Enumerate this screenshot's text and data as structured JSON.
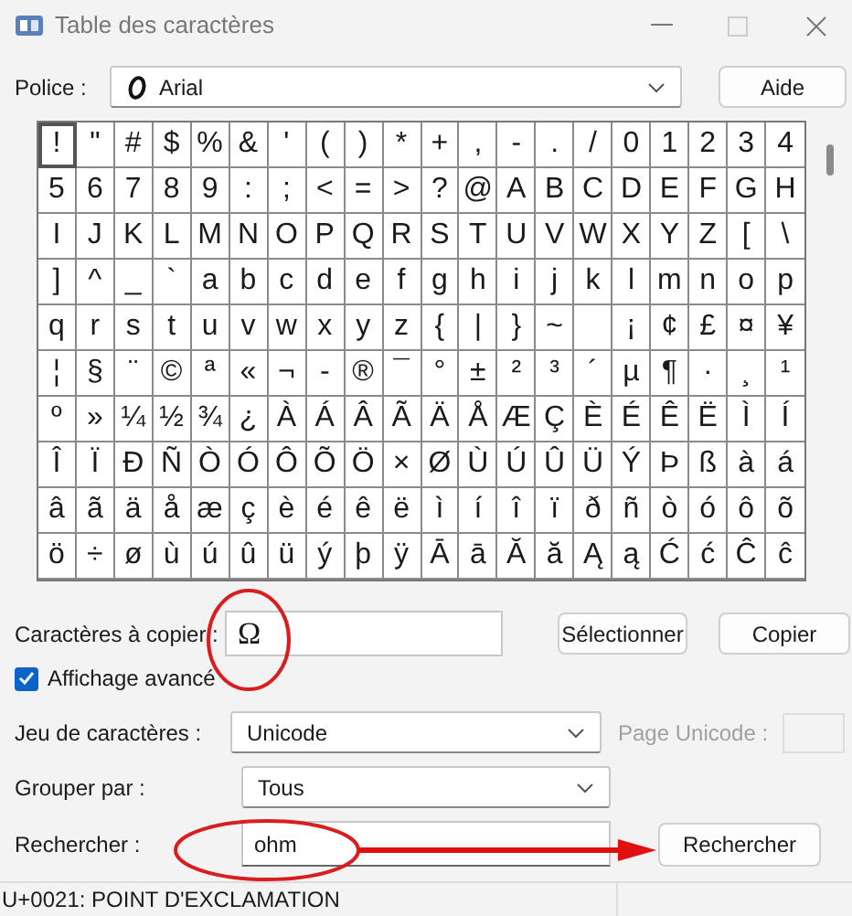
{
  "window": {
    "title": "Table des caractères"
  },
  "font": {
    "label": "Police :",
    "value": "Arial"
  },
  "help_button": "Aide",
  "grid": {
    "rows": [
      {
        "cells": [
          {
            "char": "!",
            "selected": true
          },
          {
            "char": "\"",
            "selected": false
          },
          {
            "char": "#",
            "selected": false
          },
          {
            "char": "$",
            "selected": false
          },
          {
            "char": "%",
            "selected": false
          },
          {
            "char": "&",
            "selected": false
          },
          {
            "char": "'",
            "selected": false
          },
          {
            "char": "(",
            "selected": false
          },
          {
            "char": ")",
            "selected": false
          },
          {
            "char": "*",
            "selected": false
          },
          {
            "char": "+",
            "selected": false
          },
          {
            "char": ",",
            "selected": false
          },
          {
            "char": "-",
            "selected": false
          },
          {
            "char": ".",
            "selected": false
          },
          {
            "char": "/",
            "selected": false
          },
          {
            "char": "0",
            "selected": false
          },
          {
            "char": "1",
            "selected": false
          },
          {
            "char": "2",
            "selected": false
          },
          {
            "char": "3",
            "selected": false
          },
          {
            "char": "4",
            "selected": false
          }
        ]
      },
      {
        "cells": [
          {
            "char": "5",
            "selected": false
          },
          {
            "char": "6",
            "selected": false
          },
          {
            "char": "7",
            "selected": false
          },
          {
            "char": "8",
            "selected": false
          },
          {
            "char": "9",
            "selected": false
          },
          {
            "char": ":",
            "selected": false
          },
          {
            "char": ";",
            "selected": false
          },
          {
            "char": "<",
            "selected": false
          },
          {
            "char": "=",
            "selected": false
          },
          {
            "char": ">",
            "selected": false
          },
          {
            "char": "?",
            "selected": false
          },
          {
            "char": "@",
            "selected": false
          },
          {
            "char": "A",
            "selected": false
          },
          {
            "char": "B",
            "selected": false
          },
          {
            "char": "C",
            "selected": false
          },
          {
            "char": "D",
            "selected": false
          },
          {
            "char": "E",
            "selected": false
          },
          {
            "char": "F",
            "selected": false
          },
          {
            "char": "G",
            "selected": false
          },
          {
            "char": "H",
            "selected": false
          }
        ]
      },
      {
        "cells": [
          {
            "char": "I",
            "selected": false
          },
          {
            "char": "J",
            "selected": false
          },
          {
            "char": "K",
            "selected": false
          },
          {
            "char": "L",
            "selected": false
          },
          {
            "char": "M",
            "selected": false
          },
          {
            "char": "N",
            "selected": false
          },
          {
            "char": "O",
            "selected": false
          },
          {
            "char": "P",
            "selected": false
          },
          {
            "char": "Q",
            "selected": false
          },
          {
            "char": "R",
            "selected": false
          },
          {
            "char": "S",
            "selected": false
          },
          {
            "char": "T",
            "selected": false
          },
          {
            "char": "U",
            "selected": false
          },
          {
            "char": "V",
            "selected": false
          },
          {
            "char": "W",
            "selected": false
          },
          {
            "char": "X",
            "selected": false
          },
          {
            "char": "Y",
            "selected": false
          },
          {
            "char": "Z",
            "selected": false
          },
          {
            "char": "[",
            "selected": false
          },
          {
            "char": "\\",
            "selected": false
          }
        ]
      },
      {
        "cells": [
          {
            "char": "]",
            "selected": false
          },
          {
            "char": "^",
            "selected": false
          },
          {
            "char": "_",
            "selected": false
          },
          {
            "char": "`",
            "selected": false
          },
          {
            "char": "a",
            "selected": false
          },
          {
            "char": "b",
            "selected": false
          },
          {
            "char": "c",
            "selected": false
          },
          {
            "char": "d",
            "selected": false
          },
          {
            "char": "e",
            "selected": false
          },
          {
            "char": "f",
            "selected": false
          },
          {
            "char": "g",
            "selected": false
          },
          {
            "char": "h",
            "selected": false
          },
          {
            "char": "i",
            "selected": false
          },
          {
            "char": "j",
            "selected": false
          },
          {
            "char": "k",
            "selected": false
          },
          {
            "char": "l",
            "selected": false
          },
          {
            "char": "m",
            "selected": false
          },
          {
            "char": "n",
            "selected": false
          },
          {
            "char": "o",
            "selected": false
          },
          {
            "char": "p",
            "selected": false
          }
        ]
      },
      {
        "cells": [
          {
            "char": "q",
            "selected": false
          },
          {
            "char": "r",
            "selected": false
          },
          {
            "char": "s",
            "selected": false
          },
          {
            "char": "t",
            "selected": false
          },
          {
            "char": "u",
            "selected": false
          },
          {
            "char": "v",
            "selected": false
          },
          {
            "char": "w",
            "selected": false
          },
          {
            "char": "x",
            "selected": false
          },
          {
            "char": "y",
            "selected": false
          },
          {
            "char": "z",
            "selected": false
          },
          {
            "char": "{",
            "selected": false
          },
          {
            "char": "|",
            "selected": false
          },
          {
            "char": "}",
            "selected": false
          },
          {
            "char": "~",
            "selected": false
          },
          {
            "selected": false
          },
          {
            "char": "¡",
            "selected": false
          },
          {
            "char": "¢",
            "selected": false
          },
          {
            "char": "£",
            "selected": false
          },
          {
            "char": "¤",
            "selected": false
          },
          {
            "char": "¥",
            "selected": false
          }
        ]
      },
      {
        "cells": [
          {
            "char": "¦",
            "selected": false
          },
          {
            "char": "§",
            "selected": false
          },
          {
            "char": "¨",
            "selected": false
          },
          {
            "char": "©",
            "selected": false
          },
          {
            "char": "ª",
            "selected": false
          },
          {
            "char": "«",
            "selected": false
          },
          {
            "char": "¬",
            "selected": false
          },
          {
            "char": "-",
            "selected": false
          },
          {
            "char": "®",
            "selected": false
          },
          {
            "char": "¯",
            "selected": false
          },
          {
            "char": "°",
            "selected": false
          },
          {
            "char": "±",
            "selected": false
          },
          {
            "char": "²",
            "selected": false
          },
          {
            "char": "³",
            "selected": false
          },
          {
            "char": "´",
            "selected": false
          },
          {
            "char": "µ",
            "selected": false
          },
          {
            "char": "¶",
            "selected": false
          },
          {
            "char": "·",
            "selected": false
          },
          {
            "char": "¸",
            "selected": false
          },
          {
            "char": "¹",
            "selected": false
          }
        ]
      },
      {
        "cells": [
          {
            "char": "º",
            "selected": false
          },
          {
            "char": "»",
            "selected": false
          },
          {
            "char": "¼",
            "selected": false
          },
          {
            "char": "½",
            "selected": false
          },
          {
            "char": "¾",
            "selected": false
          },
          {
            "char": "¿",
            "selected": false
          },
          {
            "char": "À",
            "selected": false
          },
          {
            "char": "Á",
            "selected": false
          },
          {
            "char": "Â",
            "selected": false
          },
          {
            "char": "Ã",
            "selected": false
          },
          {
            "char": "Ä",
            "selected": false
          },
          {
            "char": "Å",
            "selected": false
          },
          {
            "char": "Æ",
            "selected": false
          },
          {
            "char": "Ç",
            "selected": false
          },
          {
            "char": "È",
            "selected": false
          },
          {
            "char": "É",
            "selected": false
          },
          {
            "char": "Ê",
            "selected": false
          },
          {
            "char": "Ë",
            "selected": false
          },
          {
            "char": "Ì",
            "selected": false
          },
          {
            "char": "Í",
            "selected": false
          }
        ]
      },
      {
        "cells": [
          {
            "char": "Î",
            "selected": false
          },
          {
            "char": "Ï",
            "selected": false
          },
          {
            "char": "Ð",
            "selected": false
          },
          {
            "char": "Ñ",
            "selected": false
          },
          {
            "char": "Ò",
            "selected": false
          },
          {
            "char": "Ó",
            "selected": false
          },
          {
            "char": "Ô",
            "selected": false
          },
          {
            "char": "Õ",
            "selected": false
          },
          {
            "char": "Ö",
            "selected": false
          },
          {
            "char": "×",
            "selected": false
          },
          {
            "char": "Ø",
            "selected": false
          },
          {
            "char": "Ù",
            "selected": false
          },
          {
            "char": "Ú",
            "selected": false
          },
          {
            "char": "Û",
            "selected": false
          },
          {
            "char": "Ü",
            "selected": false
          },
          {
            "char": "Ý",
            "selected": false
          },
          {
            "char": "Þ",
            "selected": false
          },
          {
            "char": "ß",
            "selected": false
          },
          {
            "char": "à",
            "selected": false
          },
          {
            "char": "á",
            "selected": false
          }
        ]
      },
      {
        "cells": [
          {
            "char": "â",
            "selected": false
          },
          {
            "char": "ã",
            "selected": false
          },
          {
            "char": "ä",
            "selected": false
          },
          {
            "char": "å",
            "selected": false
          },
          {
            "char": "æ",
            "selected": false
          },
          {
            "char": "ç",
            "selected": false
          },
          {
            "char": "è",
            "selected": false
          },
          {
            "char": "é",
            "selected": false
          },
          {
            "char": "ê",
            "selected": false
          },
          {
            "char": "ë",
            "selected": false
          },
          {
            "char": "ì",
            "selected": false
          },
          {
            "char": "í",
            "selected": false
          },
          {
            "char": "î",
            "selected": false
          },
          {
            "char": "ï",
            "selected": false
          },
          {
            "char": "ð",
            "selected": false
          },
          {
            "char": "ñ",
            "selected": false
          },
          {
            "char": "ò",
            "selected": false
          },
          {
            "char": "ó",
            "selected": false
          },
          {
            "char": "ô",
            "selected": false
          },
          {
            "char": "õ",
            "selected": false
          }
        ]
      },
      {
        "cells": [
          {
            "char": "ö",
            "selected": false
          },
          {
            "char": "÷",
            "selected": false
          },
          {
            "char": "ø",
            "selected": false
          },
          {
            "char": "ù",
            "selected": false
          },
          {
            "char": "ú",
            "selected": false
          },
          {
            "char": "û",
            "selected": false
          },
          {
            "char": "ü",
            "selected": false
          },
          {
            "char": "ý",
            "selected": false
          },
          {
            "char": "þ",
            "selected": false
          },
          {
            "char": "ÿ",
            "selected": false
          },
          {
            "char": "Ā",
            "selected": false
          },
          {
            "char": "ā",
            "selected": false
          },
          {
            "char": "Ă",
            "selected": false
          },
          {
            "char": "ă",
            "selected": false
          },
          {
            "char": "Ą",
            "selected": false
          },
          {
            "char": "ą",
            "selected": false
          },
          {
            "char": "Ć",
            "selected": false
          },
          {
            "char": "ć",
            "selected": false
          },
          {
            "char": "Ĉ",
            "selected": false
          },
          {
            "char": "ĉ",
            "selected": false
          }
        ]
      }
    ]
  },
  "copy": {
    "label": "Caractères à copier :",
    "value": "Ω",
    "select_button": "Sélectionner",
    "copy_button": "Copier"
  },
  "advanced_view": {
    "label": "Affichage avancé",
    "checked": true
  },
  "charset": {
    "label": "Jeu de caractères :",
    "value": "Unicode"
  },
  "unicode_page": {
    "label": "Page Unicode :",
    "disabled": true
  },
  "group_by": {
    "label": "Grouper par :",
    "value": "Tous"
  },
  "search": {
    "label": "Rechercher :",
    "value": "ohm",
    "button": "Rechercher"
  },
  "status_bar": "U+0021: POINT D'EXCLAMATION",
  "annotations": [
    {
      "kind": "ellipse"
    },
    {
      "kind": "ellipse"
    },
    {
      "kind": "arrow"
    }
  ]
}
